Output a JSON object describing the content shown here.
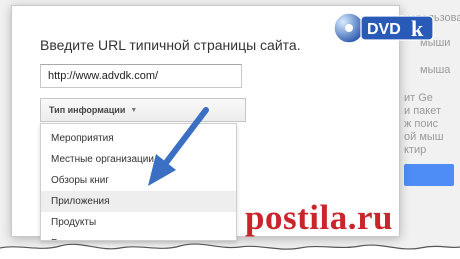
{
  "dialog": {
    "title": "Введите URL типичной страницы сайта.",
    "url_value": "http://www.advdk.com/",
    "type_dropdown": {
      "label": "Тип информации",
      "icon": "chevron-down-icon"
    }
  },
  "menu": {
    "items": [
      {
        "label": "Мероприятия"
      },
      {
        "label": "Местные организации"
      },
      {
        "label": "Обзоры книг"
      },
      {
        "label": "Приложения",
        "highlighted": true
      },
      {
        "label": "Продукты"
      },
      {
        "label": "Рест"
      }
    ]
  },
  "background": {
    "fragments": [
      "использовать разм",
      "мыши",
      "мыша",
      "ит Gе",
      "и пакет",
      "ж поис",
      "ой мыш",
      "ктир"
    ]
  },
  "logo": {
    "text": "DVD",
    "text2": "k"
  },
  "watermark": {
    "text": "postila.ru"
  },
  "colors": {
    "accent": "#4d8df5",
    "watermark": "#c9252b",
    "arrow": "#3a6fc4"
  }
}
